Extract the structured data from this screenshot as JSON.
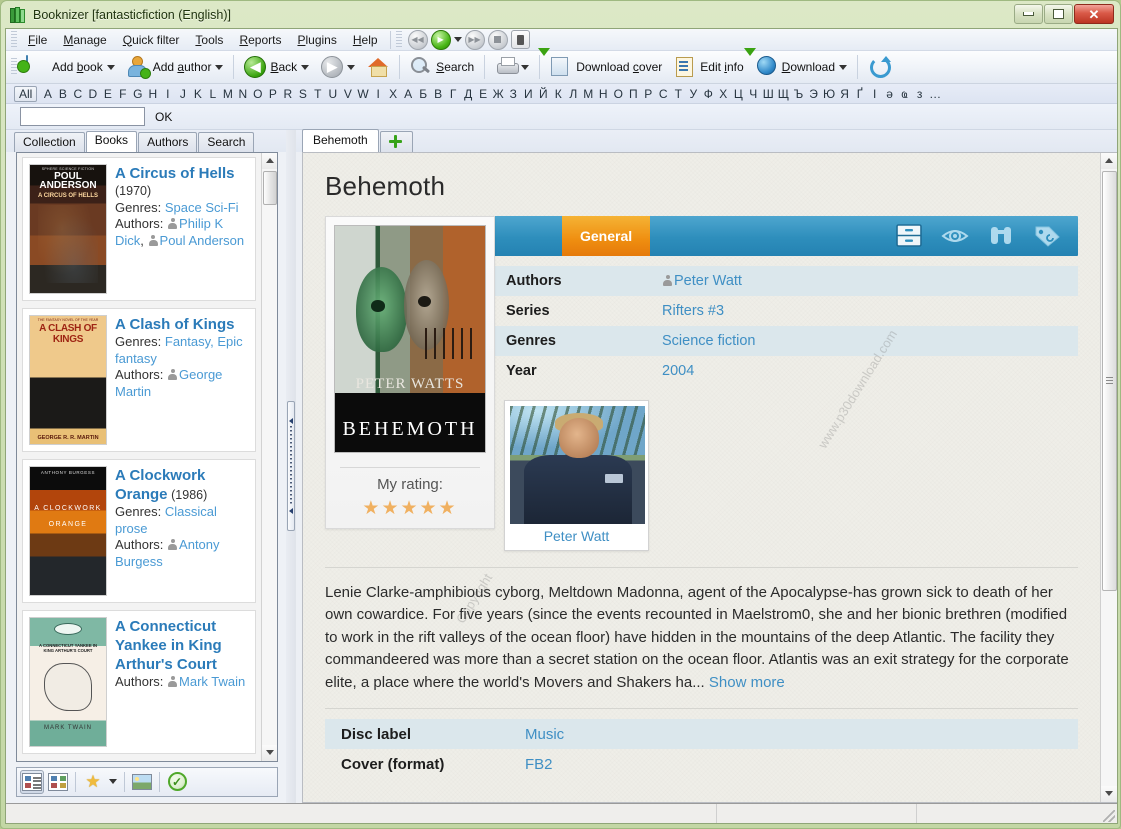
{
  "window": {
    "title": "Booknizer [fantasticfiction (English)]",
    "icon": "books-icon",
    "buttons": {
      "minimize": "minimize-button",
      "maximize": "maximize-button",
      "close": "close-button"
    }
  },
  "menubar": {
    "items": [
      "File",
      "Manage",
      "Quick filter",
      "Tools",
      "Reports",
      "Plugins",
      "Help"
    ],
    "media_controls": [
      "rewind-icon",
      "play-icon",
      "play-dropdown-icon",
      "forward-icon",
      "stop-icon",
      "speaker-icon"
    ]
  },
  "toolbar": {
    "items": [
      {
        "label": "Add book",
        "icon": "add-book-icon",
        "dropdown": true
      },
      {
        "label": "Add author",
        "icon": "add-author-icon",
        "dropdown": true
      },
      {
        "label": "Back",
        "icon": "back-arrow-icon",
        "dropdown": true
      },
      {
        "label": "",
        "icon": "forward-arrow-icon",
        "dropdown": true
      },
      {
        "label": "",
        "icon": "home-icon",
        "dropdown": false
      },
      {
        "label": "Search",
        "icon": "search-magnifier-icon",
        "dropdown": false
      },
      {
        "label": "",
        "icon": "print-icon",
        "dropdown": true
      },
      {
        "label": "Download cover",
        "icon": "download-cover-icon",
        "dropdown": false
      },
      {
        "label": "Edit info",
        "icon": "edit-info-icon",
        "dropdown": false
      },
      {
        "label": "Download",
        "icon": "download-globe-icon",
        "dropdown": true
      },
      {
        "label": "",
        "icon": "refresh-icon",
        "dropdown": false
      }
    ]
  },
  "alphabet_bar": {
    "all_label": "All",
    "letters": [
      "A",
      "B",
      "C",
      "D",
      "E",
      "F",
      "G",
      "H",
      "I",
      "J",
      "K",
      "L",
      "M",
      "N",
      "O",
      "P",
      "R",
      "S",
      "T",
      "U",
      "V",
      "W",
      "I",
      "X",
      "А",
      "Б",
      "В",
      "Г",
      "Д",
      "Е",
      "Ж",
      "З",
      "И",
      "Й",
      "К",
      "Л",
      "М",
      "Н",
      "О",
      "П",
      "Р",
      "С",
      "Т",
      "У",
      "Ф",
      "Х",
      "Ц",
      "Ч",
      "Ш",
      "Щ",
      "Ъ",
      "Э",
      "Ю",
      "Я",
      "Ґ",
      "І",
      "ә",
      "ҩ",
      "з",
      "…"
    ]
  },
  "filter_bar": {
    "input_value": "",
    "input_placeholder": "",
    "ok_label": "OK"
  },
  "left_pane": {
    "tabs": [
      {
        "label": "Collection",
        "active": false
      },
      {
        "label": "Books",
        "active": true
      },
      {
        "label": "Authors",
        "active": false
      },
      {
        "label": "Search",
        "active": false
      }
    ],
    "books": [
      {
        "title": "A Circus of Hells",
        "year": "(1970)",
        "genres_label": "Genres:",
        "genres": "Space Sci-Fi",
        "authors_label": "Authors:",
        "authors": [
          "Philip K Dick",
          "Poul Anderson"
        ],
        "cover": "circus-of-hells-cover",
        "cover_top_text": "SPHERE SCIENCE FICTION",
        "cover_author": "POUL ANDERSON",
        "cover_title": "A CIRCUS OF HELLS"
      },
      {
        "title": "A Clash of Kings",
        "year": "",
        "genres_label": "Genres:",
        "genres": "Fantasy, Epic fantasy",
        "authors_label": "Authors:",
        "authors": [
          "George Martin"
        ],
        "cover": "clash-of-kings-cover",
        "cover_top_text": "THE FANTASY NOVEL OF THE YEAR",
        "cover_title": "A CLASH OF KINGS",
        "cover_author": "GEORGE R. R. MARTIN"
      },
      {
        "title": "A Clockwork Orange",
        "year": "(1986)",
        "genres_label": "Genres:",
        "genres": "Classical prose",
        "authors_label": "Authors:",
        "authors": [
          "Antony Burgess"
        ],
        "cover": "clockwork-orange-cover",
        "cover_top_text": "ANTHONY BURGESS",
        "cover_title": "A CLOCKWORK ORANGE"
      },
      {
        "title": "A Connecticut Yankee in King Arthur's Court",
        "year": "",
        "genres_label": "",
        "genres": "",
        "authors_label": "Authors:",
        "authors": [
          "Mark Twain"
        ],
        "cover": "connecticut-yankee-cover",
        "cover_title": "A CONNECTICUT YANKEE IN KING ARTHUR'S COURT",
        "cover_author": "MARK TWAIN"
      }
    ],
    "bottom_toolbar": [
      "list-view-icon",
      "grid-view-icon",
      "star-rating-icon",
      "star-dropdown-icon",
      "image-view-icon",
      "check-status-icon"
    ]
  },
  "right_pane": {
    "tabs": [
      {
        "label": "Behemoth",
        "active": true
      },
      {
        "label": "",
        "icon": "add-tab-plus-icon",
        "active": false
      }
    ],
    "page_title": "Behemoth",
    "cover": {
      "author_text": "PETER WATTS",
      "title_text": "ΒEHEMOTH",
      "rating_label": "My rating:",
      "rating_stars": "★★★★★",
      "rating_value": 5
    },
    "detail_tabs": [
      {
        "label": "General",
        "active": true
      }
    ],
    "detail_tab_icons": [
      "cabinet-icon",
      "eye-icon",
      "binoculars-icon",
      "tag-icon"
    ],
    "fields": [
      {
        "name": "Authors",
        "value": "Peter Watt",
        "has_person_icon": true
      },
      {
        "name": "Series",
        "value": "Rifters #3",
        "has_person_icon": false
      },
      {
        "name": "Genres",
        "value": "Science fiction",
        "has_person_icon": false
      },
      {
        "name": "Year",
        "value": "2004",
        "has_person_icon": false
      }
    ],
    "author_card": {
      "name": "Peter Watt",
      "photo": "peter-watt-photo"
    },
    "description": "Lenie Clarke-amphibious cyborg, Meltdown Madonna, agent of the Apocalypse-has grown sick to death of her own cowardice. For five years (since the events recounted in Maelstrom0, she and her bionic brethren (modified to work in the rift valleys of the ocean floor) have hidden in the mountains of the deep Atlantic. The facility they commandeered was more than a secret station on the ocean floor. Atlantis was an exit strategy for the corporate elite, a place where the world's Movers and Shakers ha...",
    "show_more_label": "Show more",
    "bottom_fields": [
      {
        "name": "Disc label",
        "value": "Music"
      },
      {
        "name": "Cover (format)",
        "value": "FB2"
      }
    ]
  },
  "watermarks": [
    "www.p30download.com",
    "Copyright"
  ],
  "status_bar": {
    "pane1": "",
    "pane2": "",
    "pane3": ""
  },
  "colors": {
    "accent_blue": "#2e8ebc",
    "accent_orange": "#ef8e10",
    "link_blue": "#3f8fc4",
    "title_blue": "#2b7bb9",
    "window_frame": "#c3d7a5",
    "star_gold": "#f0b060"
  }
}
